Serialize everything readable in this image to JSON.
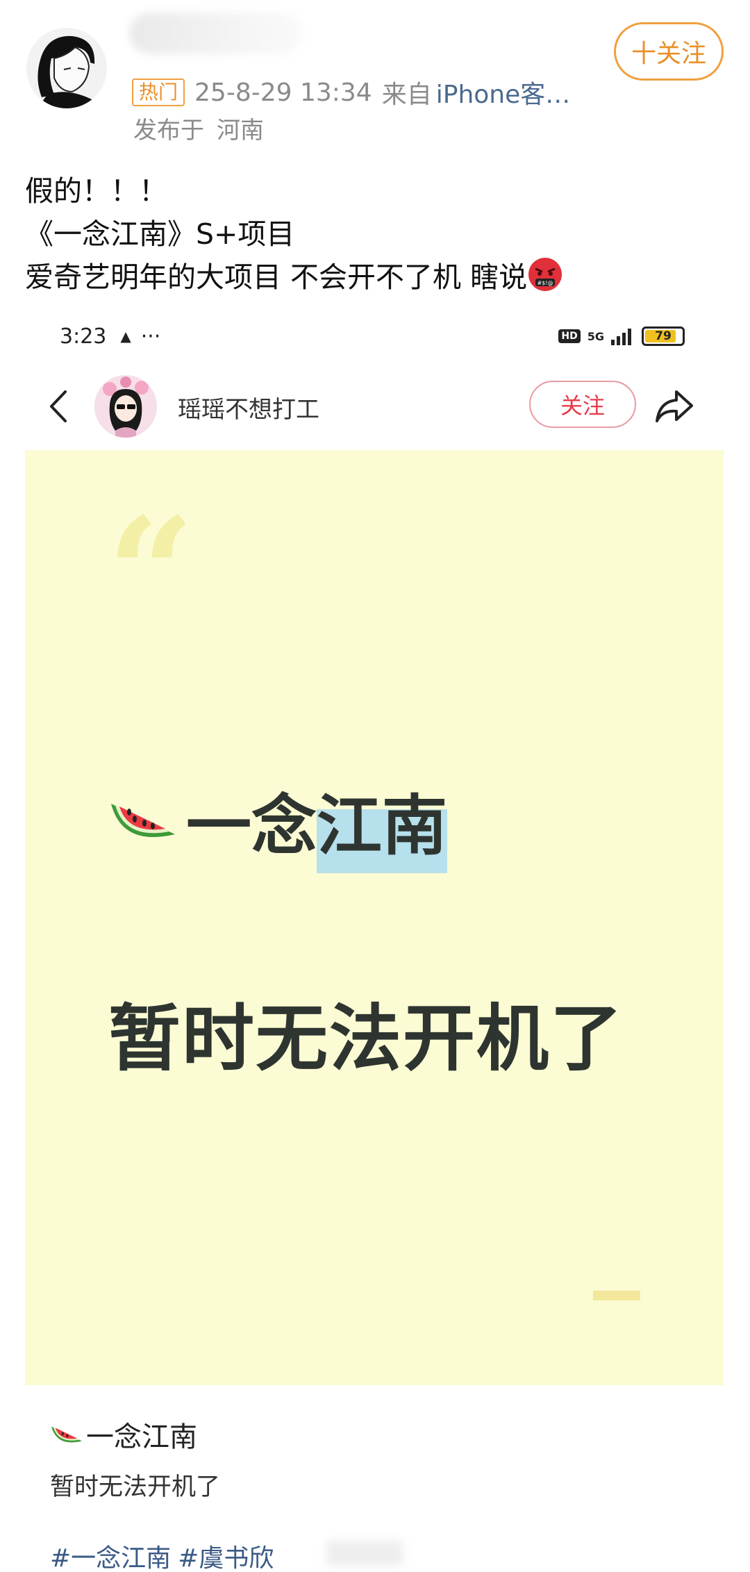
{
  "post": {
    "hot_badge": "热门",
    "timestamp": "25-8-29 13:34",
    "source_prefix": "来自",
    "source": "iPhone客…",
    "location_prefix": "发布于",
    "location": "河南",
    "follow_label": "十关注",
    "text_lines": [
      "假的！！！",
      "《一念江南》S+项目",
      "爱奇艺明年的大项目 不会开不了机 瞎说"
    ]
  },
  "embedded": {
    "status_time": "3:23",
    "status_network": "5G",
    "battery_level": "79",
    "user_name": "瑶瑶不想打工",
    "follow_label": "关注",
    "card": {
      "title": "一念江南",
      "title_plain": "一念",
      "title_highlight": "江南",
      "subtitle": "暂时无法开机了"
    },
    "caption_title": "一念江南",
    "caption_sub": "暂时无法开机了",
    "tags": [
      "#一念江南",
      "#虞书欣"
    ]
  },
  "icons": {
    "back": "chevron-left-icon",
    "share": "share-arrow-icon",
    "melon": "watermelon-icon",
    "angry": "angry-face-icon"
  },
  "colors": {
    "follow_orange": "#e8902a",
    "inner_follow_red": "#e43c4a",
    "card_bg": "#fbfbd4",
    "highlight_blue": "#b6e0ec",
    "tag_blue": "#3a5a86"
  }
}
